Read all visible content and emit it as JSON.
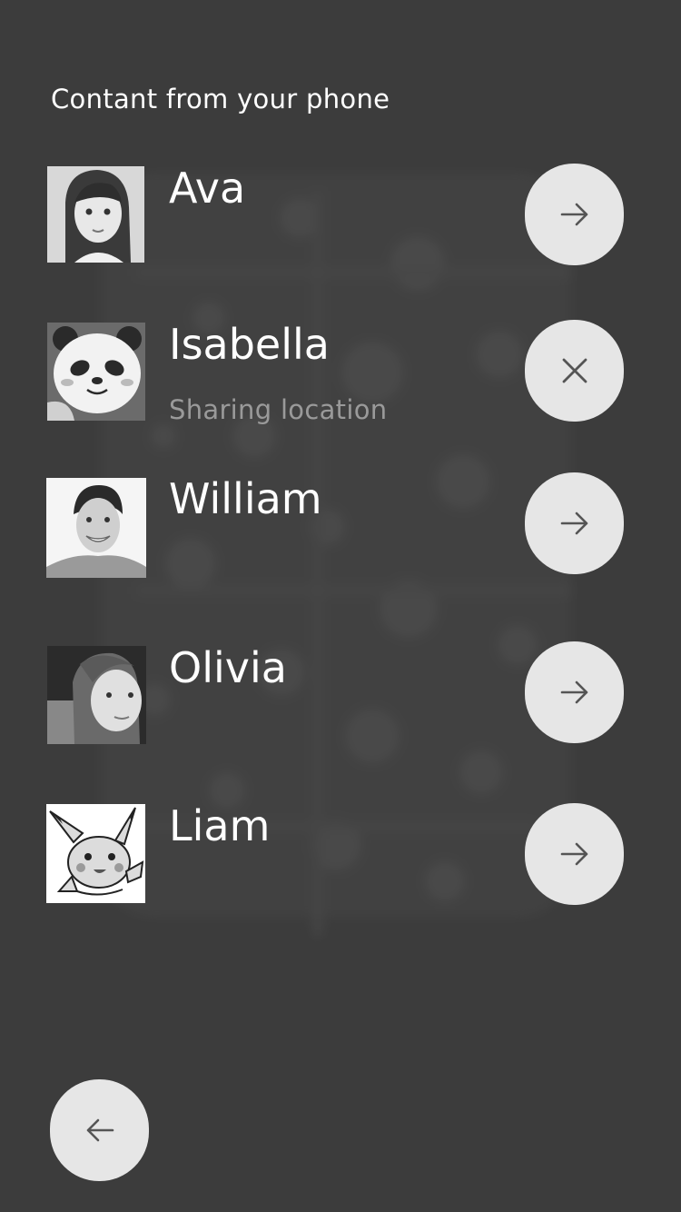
{
  "header": {
    "title": "Contant from your phone"
  },
  "contacts": [
    {
      "name": "Ava",
      "status": "",
      "action_icon": "arrow-right-icon",
      "avatar_icon": "avatar-girl-photo"
    },
    {
      "name": "Isabella",
      "status": "Sharing location",
      "action_icon": "close-icon",
      "avatar_icon": "avatar-panda-illustration"
    },
    {
      "name": "William",
      "status": "",
      "action_icon": "arrow-right-icon",
      "avatar_icon": "avatar-man-photo"
    },
    {
      "name": "Olivia",
      "status": "",
      "action_icon": "arrow-right-icon",
      "avatar_icon": "avatar-woman-photo"
    },
    {
      "name": "Liam",
      "status": "",
      "action_icon": "arrow-right-icon",
      "avatar_icon": "avatar-pikachu-illustration"
    }
  ],
  "footer": {
    "back_icon": "arrow-left-icon"
  },
  "colors": {
    "background": "#3c3c3c",
    "button": "#e6e6e6",
    "icon": "#555555",
    "text_primary": "#ffffff",
    "text_secondary": "#9a9a9a"
  }
}
